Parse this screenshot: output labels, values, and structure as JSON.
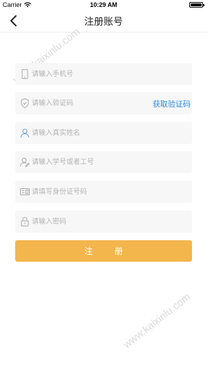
{
  "status_bar": {
    "carrier": "Carrier",
    "time": "10:29 AM"
  },
  "nav": {
    "title": "注册账号"
  },
  "form": {
    "phone": {
      "placeholder": "请输入手机号",
      "icon": "phone-icon"
    },
    "code": {
      "placeholder": "请输入验证码",
      "icon": "shield-icon",
      "action_label": "获取验证码"
    },
    "name": {
      "placeholder": "请输入真实姓名",
      "icon": "person-icon"
    },
    "student_id": {
      "placeholder": "请输入学号或者工号",
      "icon": "person-edit-icon"
    },
    "id_card": {
      "placeholder": "请填写身份证号码",
      "icon": "id-card-icon"
    },
    "password": {
      "placeholder": "请输入密码",
      "icon": "lock-icon"
    },
    "submit_label": "注 册"
  },
  "watermark": {
    "text": "www.kaixinlu.com"
  },
  "colors": {
    "accent_blue": "#2e8cd6",
    "button_orange": "#f3b64d",
    "field_bg": "#f7f7f7",
    "placeholder": "#b4b4b4"
  }
}
